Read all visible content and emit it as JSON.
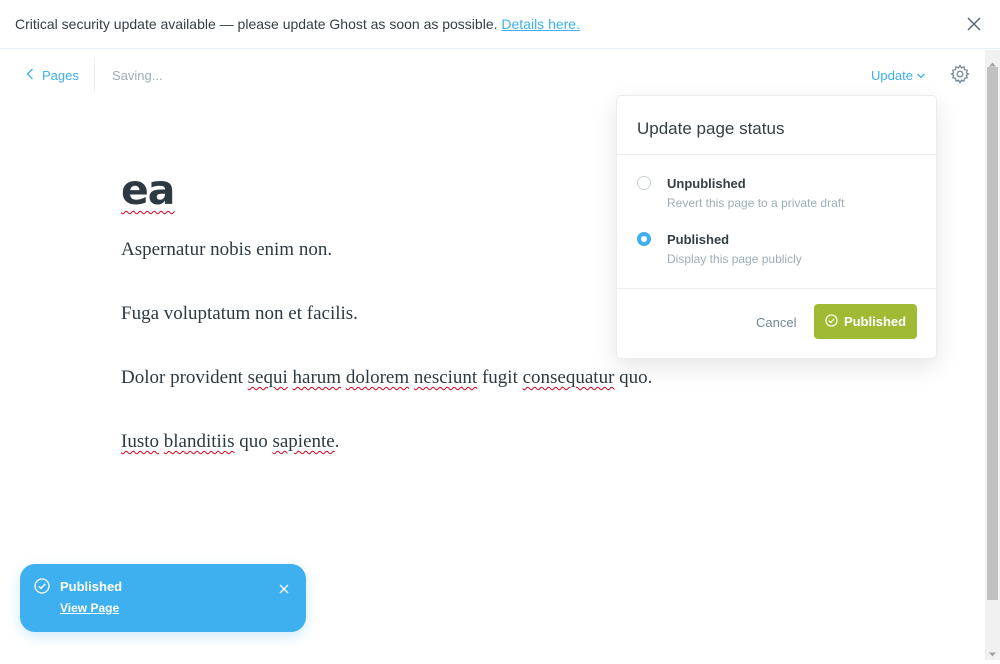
{
  "banner": {
    "message": "Critical security update available — please update Ghost as soon as possible. ",
    "link_text": "Details here."
  },
  "header": {
    "back_label": "Pages",
    "save_status": "Saving...",
    "update_label": "Update"
  },
  "document": {
    "title": "ea",
    "paragraphs": [
      "Aspernatur nobis enim non.",
      "Fuga voluptatum non et facilis.",
      "Dolor provident sequi harum dolorem nesciunt fugit consequatur quo.",
      "Iusto blanditiis quo sapiente."
    ]
  },
  "publish_menu": {
    "title": "Update page status",
    "options": [
      {
        "label": "Unpublished",
        "description": "Revert this page to a private draft",
        "selected": false
      },
      {
        "label": "Published",
        "description": "Display this page publicly",
        "selected": true
      }
    ],
    "cancel_label": "Cancel",
    "confirm_label": "Published"
  },
  "toast": {
    "title": "Published",
    "link_text": "View Page"
  },
  "icons": {
    "banner_close": "close-icon",
    "back": "chevron-left-icon",
    "update_caret": "chevron-down-icon",
    "settings": "gear-icon",
    "confirm": "check-circle-icon",
    "toast_status": "check-circle-icon",
    "toast_close": "close-icon"
  },
  "colors": {
    "accent_blue": "#3eb0ef",
    "publish_green": "#9fbb34",
    "spellcheck_red": "#d0021b",
    "muted_text": "#9baeb8"
  }
}
